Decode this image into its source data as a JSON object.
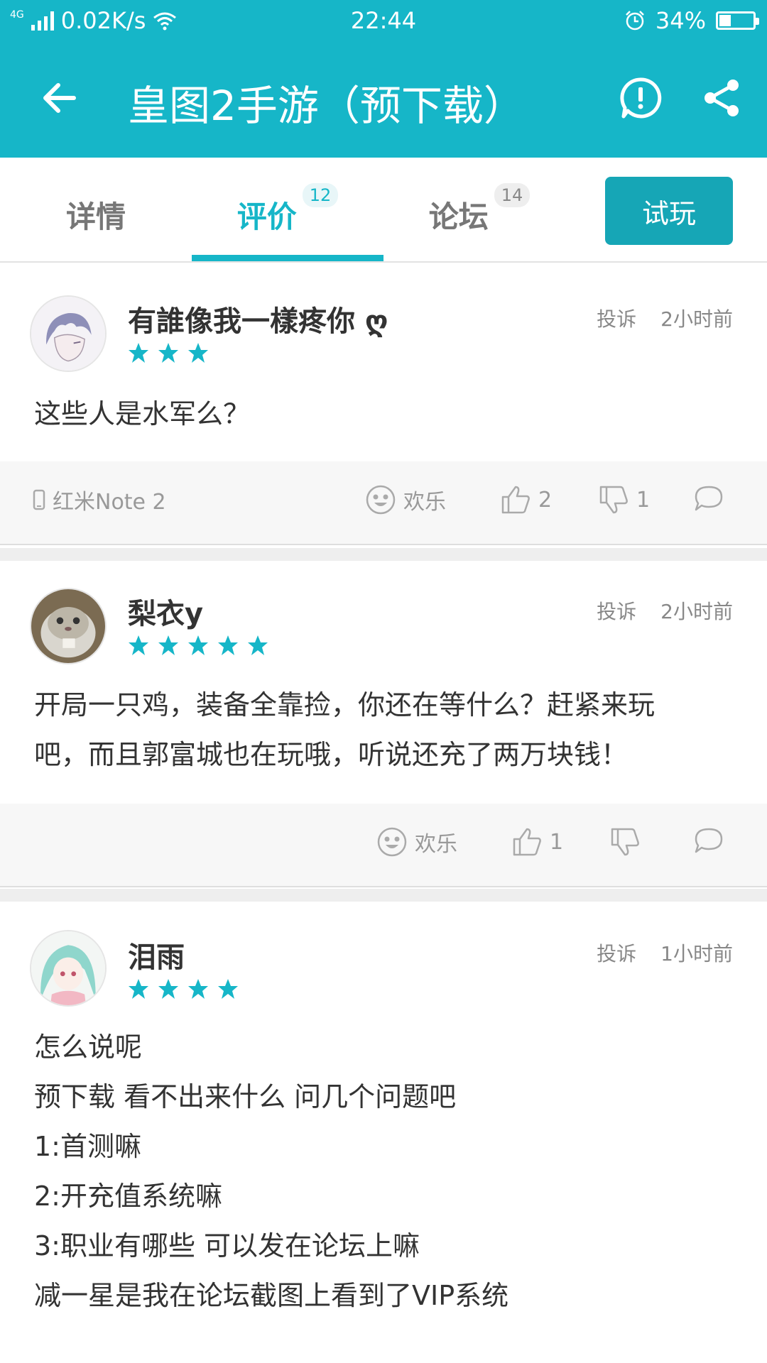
{
  "status_bar": {
    "network": "4G",
    "speed": "0.02K/s",
    "time": "22:44",
    "battery_percent": "34%",
    "battery_level": 0.34
  },
  "app_bar": {
    "title": "皇图2手游（预下载）",
    "back_icon": "arrow-left-icon",
    "report_icon": "alert-circle-icon",
    "share_icon": "share-icon"
  },
  "tabs": [
    {
      "label": "详情",
      "badge": ""
    },
    {
      "label": "评价",
      "badge": "12",
      "active": true
    },
    {
      "label": "论坛",
      "badge": "14"
    }
  ],
  "try_button": "试玩",
  "accent_color": "#16b6c8",
  "reviews": [
    {
      "user": "有誰像我一樣疼你 ღ",
      "stars": 3,
      "report": "投诉",
      "time": "2小时前",
      "lines": [
        "这些人是水军么？"
      ],
      "device": "红米Note 2",
      "mood": "欢乐",
      "likes": "2",
      "dislikes": "1"
    },
    {
      "user": "梨衣y",
      "stars": 5,
      "report": "投诉",
      "time": "2小时前",
      "lines": [
        "开局一只鸡，装备全靠捡，你还在等什么？赶紧来玩",
        "吧，而且郭富城也在玩哦，听说还充了两万块钱！"
      ],
      "device": "",
      "mood": "欢乐",
      "likes": "1",
      "dislikes": ""
    },
    {
      "user": "泪雨",
      "stars": 4,
      "report": "投诉",
      "time": "1小时前",
      "lines": [
        "怎么说呢",
        "预下载 看不出来什么 问几个问题吧",
        "1:首测嘛",
        "2:开充值系统嘛",
        "3:职业有哪些 可以发在论坛上嘛",
        "减一星是我在论坛截图上看到了VIP系统"
      ]
    }
  ]
}
